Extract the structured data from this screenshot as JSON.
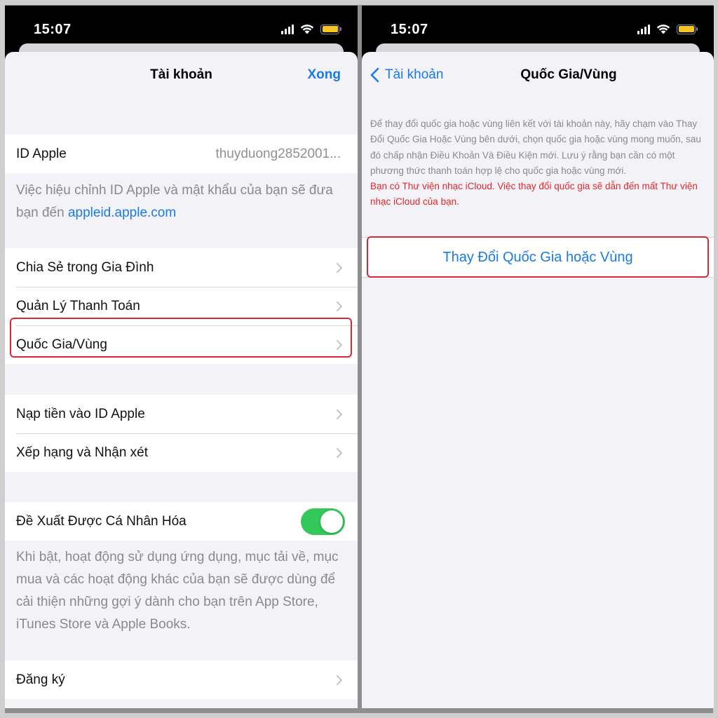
{
  "status_bar": {
    "time": "15:07"
  },
  "left_screen": {
    "nav": {
      "title": "Tài khoản",
      "done_label": "Xong"
    },
    "apple_id": {
      "label": "ID Apple",
      "value": "thuyduong2852001..."
    },
    "apple_id_footer": {
      "text": "Việc hiệu chỉnh ID Apple và mật khẩu của bạn sẽ đưa bạn đến ",
      "link": "appleid.apple.com"
    },
    "group1": [
      {
        "label": "Chia Sẻ trong Gia Đình"
      },
      {
        "label": "Quản Lý Thanh Toán"
      },
      {
        "label": "Quốc Gia/Vùng"
      }
    ],
    "group2": [
      {
        "label": "Nạp tiền vào ID Apple"
      },
      {
        "label": "Xếp hạng và Nhận xét"
      }
    ],
    "personalized": {
      "label": "Đề Xuất Được Cá Nhân Hóa",
      "enabled": true
    },
    "personalized_footer": "Khi bật, hoạt động sử dụng ứng dụng, mục tải về, mục mua và các hoạt động khác của bạn sẽ được dùng để cải thiện những gợi ý dành cho bạn trên App Store, iTunes Store và Apple Books.",
    "subscriptions": {
      "label": "Đăng ký"
    }
  },
  "right_screen": {
    "nav": {
      "back_label": "Tài khoản",
      "title": "Quốc Gia/Vùng"
    },
    "info": "Để thay đổi quốc gia hoặc vùng liên kết với tài khoản này, hãy chạm vào Thay Đổi Quốc Gia Hoặc Vùng bên dưới, chọn quốc gia hoặc vùng mong muốn, sau đó chấp nhận Điều Khoản Và Điều Kiện mới. Lưu ý rằng bạn cần có một phương thức thanh toán hợp lệ cho quốc gia hoặc vùng mới.",
    "warning": "Bạn có Thư viện nhạc iCloud. Việc thay đổi quốc gia sẽ dẫn đến mất Thư viện nhạc iCloud của bạn.",
    "action_label": "Thay Đổi Quốc Gia hoặc Vùng"
  },
  "colors": {
    "accent": "#1a7ae6",
    "highlight": "#d7283a",
    "warning": "#e3272b",
    "toggle_on": "#34c759"
  }
}
